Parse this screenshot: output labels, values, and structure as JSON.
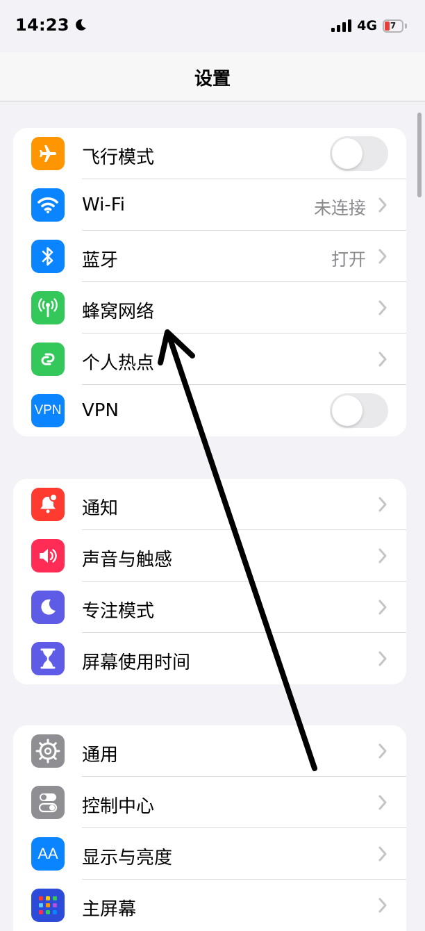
{
  "status_bar": {
    "time": "14:23",
    "network": "4G",
    "battery": "7"
  },
  "nav": {
    "title": "设置"
  },
  "groups": [
    {
      "items": [
        {
          "label": "飞行模式",
          "icon": "airplane-icon",
          "color": "#ff9500",
          "control": "toggle",
          "toggle_on": false
        },
        {
          "label": "Wi-Fi",
          "icon": "wifi-icon",
          "color": "#0a84ff",
          "value": "未连接"
        },
        {
          "label": "蓝牙",
          "icon": "bluetooth-icon",
          "color": "#0a84ff",
          "value": "打开"
        },
        {
          "label": "蜂窝网络",
          "icon": "cellular-icon",
          "color": "#34c759"
        },
        {
          "label": "个人热点",
          "icon": "hotspot-icon",
          "color": "#34c759"
        },
        {
          "label": "VPN",
          "icon": "vpn-icon",
          "icon_text": "VPN",
          "color": "#0a84ff",
          "control": "toggle",
          "toggle_on": false
        }
      ]
    },
    {
      "items": [
        {
          "label": "通知",
          "icon": "notification-icon",
          "color": "#ff3b30"
        },
        {
          "label": "声音与触感",
          "icon": "sound-icon",
          "color": "#ff2d55"
        },
        {
          "label": "专注模式",
          "icon": "moon-icon",
          "color": "#5e5ce6"
        },
        {
          "label": "屏幕使用时间",
          "icon": "hourglass-icon",
          "color": "#5e5ce6"
        }
      ]
    },
    {
      "items": [
        {
          "label": "通用",
          "icon": "gear-icon",
          "color": "#8e8e93"
        },
        {
          "label": "控制中心",
          "icon": "control-center-icon",
          "color": "#8e8e93"
        },
        {
          "label": "显示与亮度",
          "icon": "display-icon",
          "icon_text": "AA",
          "color": "#0a84ff"
        },
        {
          "label": "主屏幕",
          "icon": "home-screen-icon",
          "color": "#2c4bd8"
        }
      ]
    }
  ]
}
